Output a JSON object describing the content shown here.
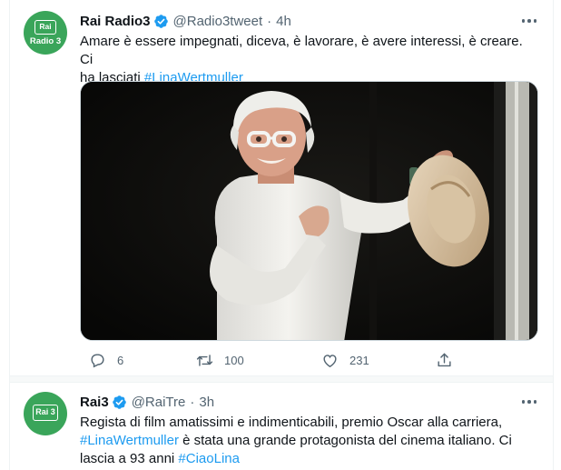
{
  "tweets": [
    {
      "avatar_logo": "Rai",
      "avatar_sub": "Radio 3",
      "name": "Rai Radio3",
      "handle": "@Radio3tweet",
      "separator": "·",
      "time": "4h",
      "text_line1": "Amare è essere impegnati, diceva, è lavorare, è avere interessi, è creare. Ci",
      "text_line2_prefix": "ha lasciati ",
      "hashtag": "#LinaWertmuller",
      "reply_count": "6",
      "retweet_count": "100",
      "like_count": "231"
    },
    {
      "avatar_logo": "Rai 3",
      "name": "Rai3",
      "handle": "@RaiTre",
      "separator": "·",
      "time": "3h",
      "text_line1": "Regista di film amatissimi e indimenticabili, premio Oscar alla carriera,",
      "hashtag1": "#LinaWertmuller",
      "text_line2_rest": " è stata una grande protagonista del cinema italiano. Ci",
      "text_line3_prefix": "lascia a 93 anni ",
      "hashtag2": "#CiaoLina"
    }
  ],
  "colors": {
    "accent": "#1d9bf0",
    "text": "#0f1419",
    "secondary": "#536471",
    "avatar_green": "#3aa55a"
  },
  "icons": [
    "verified-badge-icon",
    "more-icon",
    "reply-icon",
    "retweet-icon",
    "like-icon",
    "share-icon"
  ]
}
